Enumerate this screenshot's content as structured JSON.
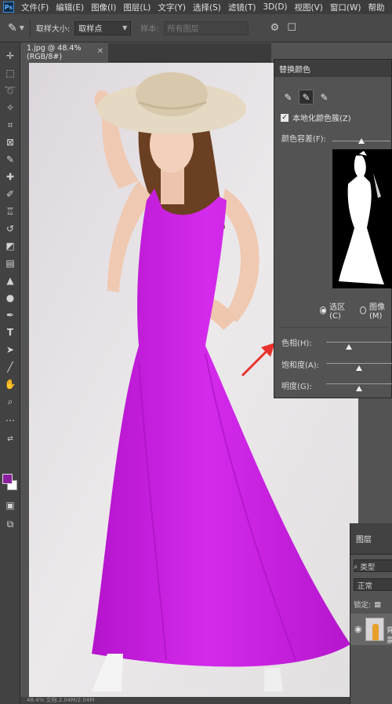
{
  "menubar": {
    "logo": "Ps",
    "items": [
      "文件(F)",
      "编辑(E)",
      "图像(I)",
      "图层(L)",
      "文字(Y)",
      "选择(S)",
      "滤镜(T)",
      "3D(D)",
      "视图(V)",
      "窗口(W)",
      "帮助"
    ]
  },
  "options": {
    "sample_size_label": "取样大小:",
    "sample_size_value": "取样点",
    "sample_label": "样本:",
    "sample_value": "所有图层"
  },
  "document": {
    "tab_title": "1.jpg @ 48.4%(RGB/8#)",
    "status": "48.4%    文档:2.04M/2.04M"
  },
  "replace_color": {
    "title": "替换颜色",
    "localized_label": "本地化颜色簇(Z)",
    "localized_checked": true,
    "fuzziness_label": "颜色容差(F):",
    "fuzziness_level": 0.5,
    "selection_label": "选区(C)",
    "image_label": "图像(M)",
    "selected_mode": "选区(C)",
    "hue_label": "色相(H):",
    "hue_level": 0.35,
    "saturation_label": "饱和度(A):",
    "saturation_level": 0.5,
    "lightness_label": "明度(G):",
    "lightness_level": 0.5
  },
  "layers": {
    "tab_label": "图层",
    "filter_label": "类型",
    "blend_mode": "正常",
    "lock_label": "锁定:",
    "layer_name": "背景"
  },
  "colors": {
    "foreground": "#8a1f9e",
    "background": "#ffffff",
    "dress": "#c71ee0",
    "annotation_arrow": "#e8322b"
  },
  "icons": {
    "tools": [
      "move-icon",
      "marquee-icon",
      "lasso-icon",
      "quick-select-icon",
      "crop-icon",
      "frame-icon",
      "eyedropper-icon",
      "healing-icon",
      "brush-icon",
      "stamp-icon",
      "history-brush-icon",
      "eraser-icon",
      "gradient-icon",
      "blur-icon",
      "dodge-icon",
      "pen-icon",
      "type-icon",
      "path-select-icon",
      "line-icon",
      "hand-icon",
      "zoom-icon",
      "more-icon"
    ]
  }
}
